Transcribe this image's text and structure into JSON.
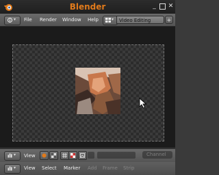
{
  "window": {
    "title": "Blender",
    "controls": {
      "minimize": "_",
      "maximize": "□",
      "close": "✕"
    }
  },
  "top_header": {
    "editor_icon": "image-editor-icon",
    "menus": [
      "File",
      "Render",
      "Window",
      "Help"
    ],
    "screen_layout": {
      "icon": "screen-layout-icon",
      "value": "Video Editing",
      "add": "+"
    }
  },
  "viewport": {
    "content": "sequencer-preview-image",
    "cursor": "mouse-pointer-icon"
  },
  "preview_header": {
    "editor_icon": "editor-type-icon",
    "view_label": "View",
    "channel_label": "Channel"
  },
  "sequencer_header": {
    "editor_icon": "editor-type-icon",
    "menus": [
      "View",
      "Select",
      "Marker",
      "Add",
      "Frame",
      "Strip"
    ]
  },
  "colors": {
    "brand": "#e07a1b",
    "header": "#606060",
    "viewport_bg": "#1b1b1b"
  }
}
